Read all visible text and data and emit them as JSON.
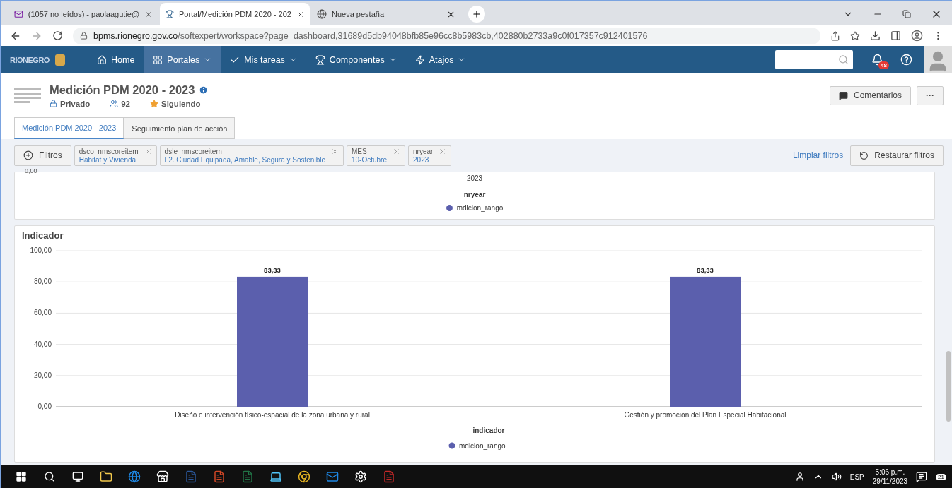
{
  "browser": {
    "tabs": [
      {
        "title": "(1057 no leídos) - paolaagutie@",
        "selected": false
      },
      {
        "title": "Portal/Medición PDM 2020 - 202",
        "selected": true
      },
      {
        "title": "Nueva pestaña",
        "selected": false
      }
    ],
    "url_host": "bpms.rionegro.gov.co",
    "url_path": "/softexpert/workspace?page=dashboard,31689d5db94048bfb85e96cc8b5983cb,402880b2733a9c0f017357c912401576"
  },
  "nav": {
    "logo": "RIONEGRO",
    "items": [
      {
        "label": "Home",
        "selected": false
      },
      {
        "label": "Portales",
        "selected": true
      },
      {
        "label": "Mis tareas",
        "selected": false
      },
      {
        "label": "Componentes",
        "selected": false
      },
      {
        "label": "Atajos",
        "selected": false
      }
    ],
    "notifications": "48"
  },
  "header": {
    "title": "Medición PDM 2020 - 2023",
    "privacy": "Privado",
    "members": "92",
    "following": "Siguiendo",
    "comments_button": "Comentarios",
    "more_button": "···"
  },
  "tabs": [
    {
      "label": "Medición PDM 2020 - 2023",
      "selected": true
    },
    {
      "label": "Seguimiento plan de acción",
      "selected": false
    }
  ],
  "filters": {
    "button": "Filtros",
    "chips": [
      {
        "name": "dsco_nmscoreitem",
        "value": "Hábitat y Vivienda"
      },
      {
        "name": "dsle_nmscoreitem",
        "value": "L2. Ciudad Equipada, Amable, Segura y Sostenible"
      },
      {
        "name": "MES",
        "value": "10-Octubre"
      },
      {
        "name": "nryear",
        "value": "2023"
      }
    ],
    "clear_link": "Limpiar filtros",
    "restore_button": "Restaurar filtros"
  },
  "previous_chart": {
    "y_tick": "0,00",
    "category": "2023",
    "xlabel": "nryear",
    "legend": "mdicion_rango"
  },
  "indicator_card": {
    "title": "Indicador",
    "chart_data": {
      "type": "bar",
      "xlabel": "indicador",
      "categories": [
        "Diseño e intervención físico-espacial de la zona urbana y rural",
        "Gestión y promoción del Plan Especial Habitacional"
      ],
      "series": [
        {
          "name": "mdicion_rango",
          "color": "#5b5fad",
          "values": [
            83.3,
            83.3
          ]
        }
      ],
      "grid": true,
      "ylim": [
        0,
        100
      ],
      "yticks": [
        {
          "value": 0,
          "label": "0,00"
        },
        {
          "value": 20,
          "label": "20,00"
        },
        {
          "value": 40,
          "label": "40,00"
        },
        {
          "value": 60,
          "label": "60,00"
        },
        {
          "value": 80,
          "label": "80,00"
        },
        {
          "value": 100,
          "label": "100,00"
        }
      ],
      "value_labels": [
        "83,33",
        "83,33"
      ]
    }
  },
  "taskbar": {
    "language": "ESP",
    "time": "5:06 p.m.",
    "date": "29/11/2023",
    "notifications": "21"
  }
}
